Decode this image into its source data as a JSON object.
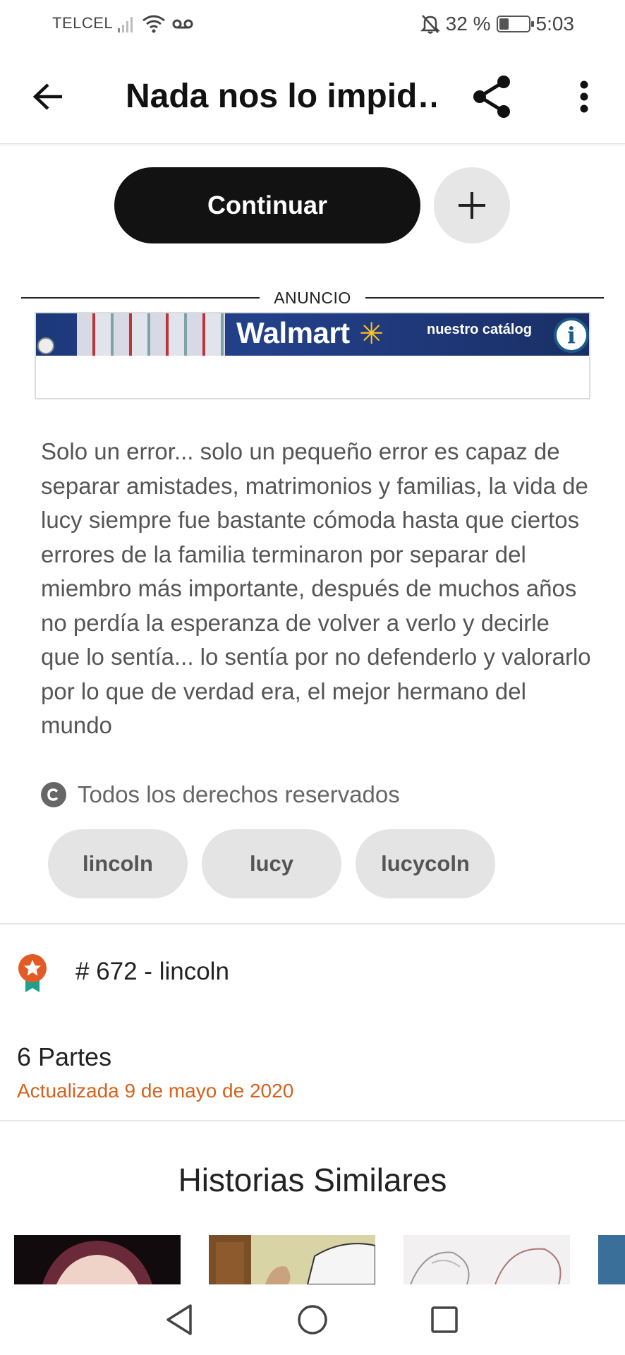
{
  "status_bar": {
    "carrier": "TELCEL",
    "battery_percent": "32 %",
    "battery_level": 0.32,
    "time": "5:03",
    "icons": [
      "signal-icon",
      "wifi-icon",
      "voicemail-icon",
      "mute-bell-icon",
      "battery-icon"
    ]
  },
  "app_bar": {
    "title": "Nada nos lo impid…",
    "back_icon": "back-arrow-icon",
    "share_icon": "share-icon",
    "more_icon": "more-vert-icon"
  },
  "actions": {
    "continue_label": "Continuar",
    "add_icon": "plus-icon"
  },
  "ad": {
    "label": "ANUNCIO",
    "brand": "Walmart",
    "brand_text": "nuestro catálog",
    "info_icon": "info-icon"
  },
  "story": {
    "description": "Solo un error... solo un pequeño error es capaz de separar amistades, matrimonios y familias, la vida de lucy siempre fue bastante cómoda hasta que ciertos errores de la familia terminaron por separar del miembro más importante, después de muchos años no perdía la esperanza de volver a verlo y decirle que lo sentía... lo sentía por no defenderlo y valorarlo por lo que de verdad era, el mejor hermano del mundo",
    "copyright": "Todos los derechos reservados",
    "tags": [
      "lincoln",
      "lucy",
      "lucycoln"
    ],
    "ranking": "# 672 - lincoln",
    "parts": "6 Partes",
    "updated": "Actualizada 9 de mayo de 2020"
  },
  "similar": {
    "title": "Historias Similares"
  },
  "colors": {
    "accent_orange": "#d5611c",
    "continue_bg": "#121212",
    "tag_bg": "#e4e4e4",
    "ad_blue": "#23408a"
  }
}
